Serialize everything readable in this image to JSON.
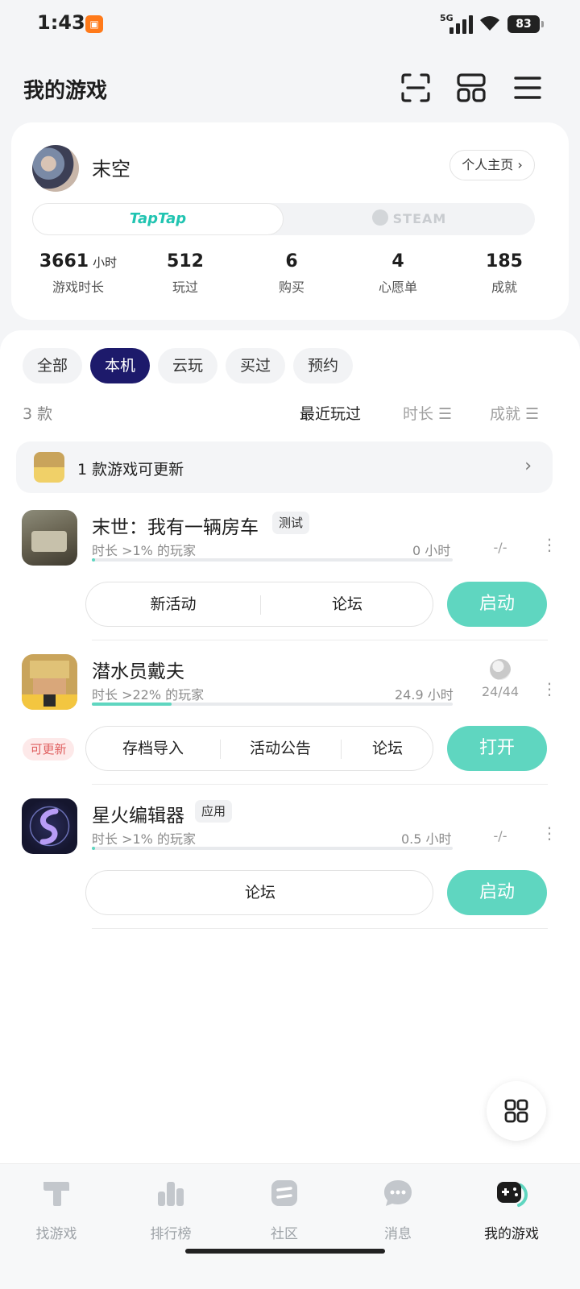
{
  "status_bar": {
    "time": "1:43",
    "network": "5G",
    "battery": "83"
  },
  "header": {
    "title": "我的游戏"
  },
  "profile": {
    "username": "末空",
    "homepage_label": "个人主页 ›",
    "platforms": {
      "active": "TapTap",
      "inactive": "STEAM"
    },
    "stats": [
      {
        "value": "3661",
        "unit": "小时",
        "label": "游戏时长"
      },
      {
        "value": "512",
        "unit": "",
        "label": "玩过"
      },
      {
        "value": "6",
        "unit": "",
        "label": "购买"
      },
      {
        "value": "4",
        "unit": "",
        "label": "心愿单"
      },
      {
        "value": "185",
        "unit": "",
        "label": "成就"
      }
    ]
  },
  "filters": {
    "chips": [
      "全部",
      "本机",
      "云玩",
      "买过",
      "预约"
    ],
    "selected": "本机"
  },
  "list_meta": {
    "count": "3 款",
    "sort_recent": "最近玩过",
    "sort_duration": "时长 ☰",
    "sort_achievement": "成就 ☰"
  },
  "update_banner": {
    "text": "1 款游戏可更新"
  },
  "games": [
    {
      "title": "末世：我有一辆房车",
      "tag": "测试",
      "subtitle": "时长 >1% 的玩家",
      "hours": "0 小时",
      "progress": 0.01,
      "achievements": "-/-",
      "actions": [
        "新活动",
        "论坛"
      ],
      "button": "启动"
    },
    {
      "title": "潜水员戴夫",
      "tag": "",
      "subtitle": "时长 >22% 的玩家",
      "hours": "24.9 小时",
      "progress": 0.22,
      "achievements": "24/44",
      "badge": "可更新",
      "actions": [
        "存档导入",
        "活动公告",
        "论坛"
      ],
      "button": "打开"
    },
    {
      "title": "星火编辑器",
      "tag": "应用",
      "subtitle": "时长 >1% 的玩家",
      "hours": "0.5 小时",
      "progress": 0.01,
      "achievements": "-/-",
      "actions": [
        "论坛"
      ],
      "button": "启动"
    }
  ],
  "bottom_nav": [
    {
      "label": "找游戏",
      "icon": "taptap-logo-icon"
    },
    {
      "label": "排行榜",
      "icon": "ranking-icon"
    },
    {
      "label": "社区",
      "icon": "community-icon"
    },
    {
      "label": "消息",
      "icon": "message-icon"
    },
    {
      "label": "我的游戏",
      "icon": "gamepad-icon",
      "active": true
    }
  ],
  "colors": {
    "accent": "#5fd6c0",
    "chip_active": "#1d1a6b",
    "taptap": "#21c4b1",
    "badge_red": "#e06060"
  }
}
